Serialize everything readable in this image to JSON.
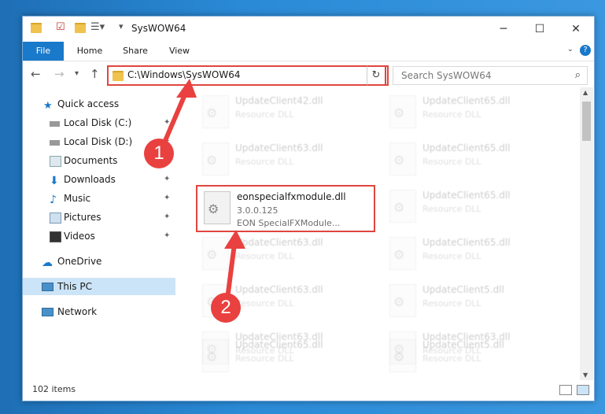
{
  "window": {
    "title": "SysWOW64",
    "minimize": "─",
    "maximize": "☐",
    "close": "✕"
  },
  "ribbon": {
    "tabs": [
      "File",
      "Home",
      "Share",
      "View"
    ],
    "help": "?"
  },
  "nav": {
    "back": "←",
    "forward": "→",
    "recent": "▾",
    "up": "↑",
    "address": "C:\\Windows\\SysWOW64",
    "refresh": "↻",
    "search_placeholder": "Search SysWOW64"
  },
  "sidebar": {
    "items": [
      {
        "label": "Quick access",
        "icon": "star-icon",
        "pinned": false
      },
      {
        "label": "Local Disk (C:)",
        "icon": "drive-icon",
        "pinned": true
      },
      {
        "label": "Local Disk (D:)",
        "icon": "drive-icon",
        "pinned": true
      },
      {
        "label": "Documents",
        "icon": "documents-icon",
        "pinned": true
      },
      {
        "label": "Downloads",
        "icon": "download-icon",
        "pinned": true
      },
      {
        "label": "Music",
        "icon": "music-icon",
        "pinned": true
      },
      {
        "label": "Pictures",
        "icon": "pictures-icon",
        "pinned": true
      },
      {
        "label": "Videos",
        "icon": "videos-icon",
        "pinned": true
      },
      {
        "label": "OneDrive",
        "icon": "cloud-icon",
        "pinned": false
      },
      {
        "label": "This PC",
        "icon": "computer-icon",
        "pinned": false,
        "selected": true
      },
      {
        "label": "Network",
        "icon": "network-icon",
        "pinned": false
      }
    ]
  },
  "files": [
    {
      "name": "UpdateClient42.dll",
      "line2": "Resource DLL",
      "line3": ""
    },
    {
      "name": "UpdateClient65.dll",
      "line2": "Resource DLL",
      "line3": ""
    },
    {
      "name": "UpdateClient63.dll",
      "line2": "Resource DLL",
      "line3": ""
    },
    {
      "name": "UpdateClient65.dll",
      "line2": "Resource DLL",
      "line3": ""
    },
    {
      "name": "eonspecialfxmodule.dll",
      "line2": "3.0.0.125",
      "line3": "EON SpecialFXModule..."
    },
    {
      "name": "UpdateClient65.dll",
      "line2": "Resource DLL",
      "line3": ""
    },
    {
      "name": "UpdateClient63.dll",
      "line2": "Resource DLL",
      "line3": ""
    },
    {
      "name": "UpdateClient65.dll",
      "line2": "Resource DLL",
      "line3": ""
    },
    {
      "name": "UpdateClient63.dll",
      "line2": "Resource DLL",
      "line3": ""
    },
    {
      "name": "UpdateClient5.dll",
      "line2": "Resource DLL",
      "line3": ""
    },
    {
      "name": "UpdateClient63.dll",
      "line2": "Resource DLL",
      "line3": ""
    },
    {
      "name": "UpdateClient63.dll",
      "line2": "Resource DLL",
      "line3": ""
    },
    {
      "name": "UpdateClient65.dll",
      "line2": "Resource DLL",
      "line3": ""
    },
    {
      "name": "UpdateClient5.dll",
      "line2": "Resource DLL",
      "line3": ""
    }
  ],
  "status": {
    "count": "102 items"
  },
  "annotations": {
    "step1": "1",
    "step2": "2"
  },
  "colors": {
    "accent": "#1979ca",
    "highlight": "#e0463f",
    "selection": "#cce4f7"
  }
}
